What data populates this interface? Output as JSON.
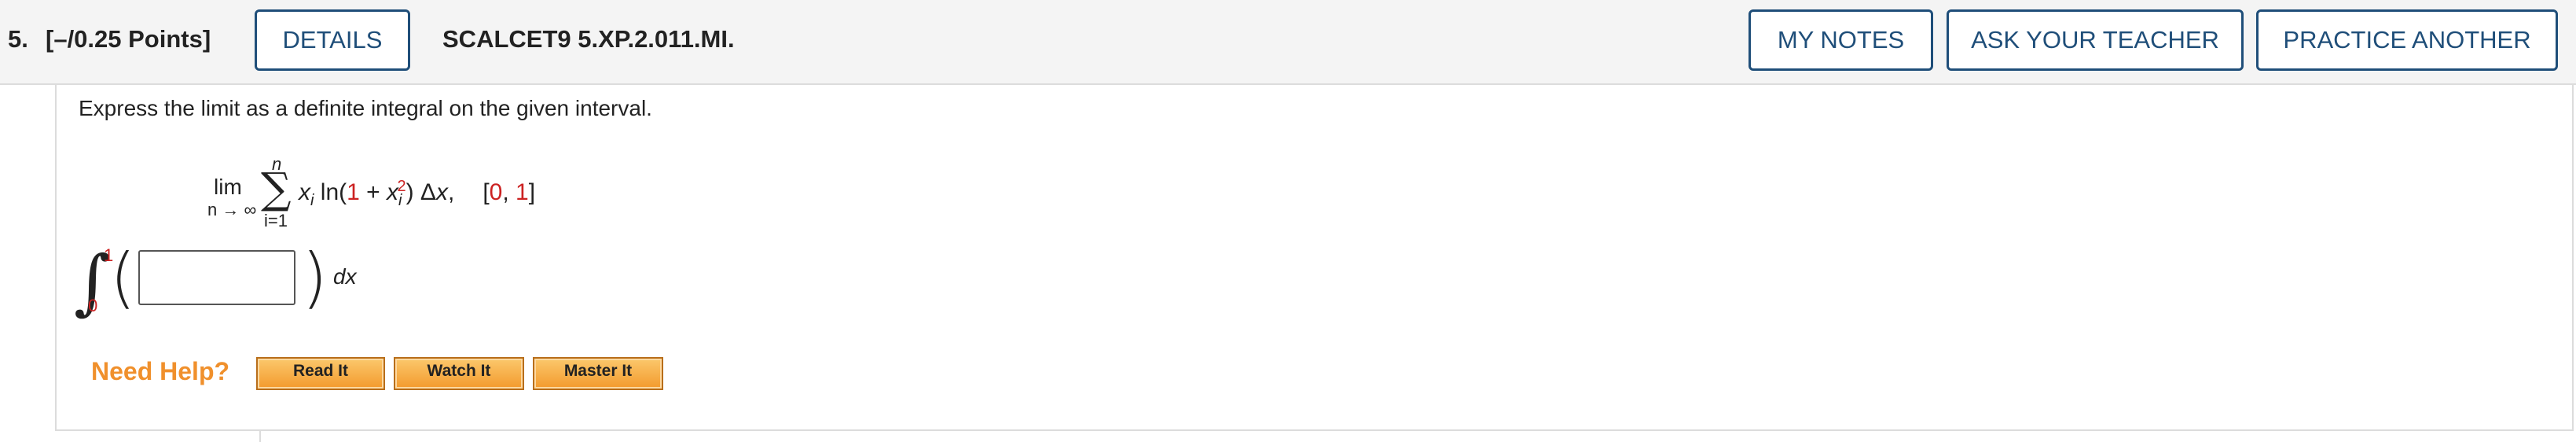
{
  "header": {
    "question_number": "5.",
    "points": "[–/0.25 Points]",
    "details_label": "DETAILS",
    "problem_code": "SCALCET9 5.XP.2.011.MI.",
    "my_notes_label": "MY NOTES",
    "ask_teacher_label": "ASK YOUR TEACHER",
    "practice_label": "PRACTICE ANOTHER",
    "accent_color": "#1f4e79"
  },
  "question": {
    "prompt": "Express the limit as a definite integral on the given interval.",
    "lim_word": "lim",
    "lim_sub": "n → ∞",
    "sigma": "∑",
    "sum_upper": "n",
    "sum_lower": "i=1",
    "expr_xi": "x",
    "expr_i": "i",
    "expr_ln": " ln(",
    "expr_one": "1",
    "expr_plus": " + ",
    "expr_x": "x",
    "expr_i2": "i",
    "expr_exp": "2",
    "expr_close": ") Δ",
    "expr_dx": "x",
    "expr_comma": ",",
    "interval_open": "[",
    "interval_a": "0",
    "interval_sep": ", ",
    "interval_b": "1",
    "interval_close": "]",
    "red_color": "#cc2222"
  },
  "answer": {
    "integral_symbol": "∫",
    "upper_limit": "1",
    "lower_limit": "0",
    "paren_left": "(",
    "paren_right": ")",
    "input_value": "",
    "dx_label": "dx"
  },
  "help": {
    "need_help_label": "Need Help?",
    "read_label": "Read It",
    "watch_label": "Watch It",
    "master_label": "Master It",
    "help_color": "#f0902c"
  }
}
